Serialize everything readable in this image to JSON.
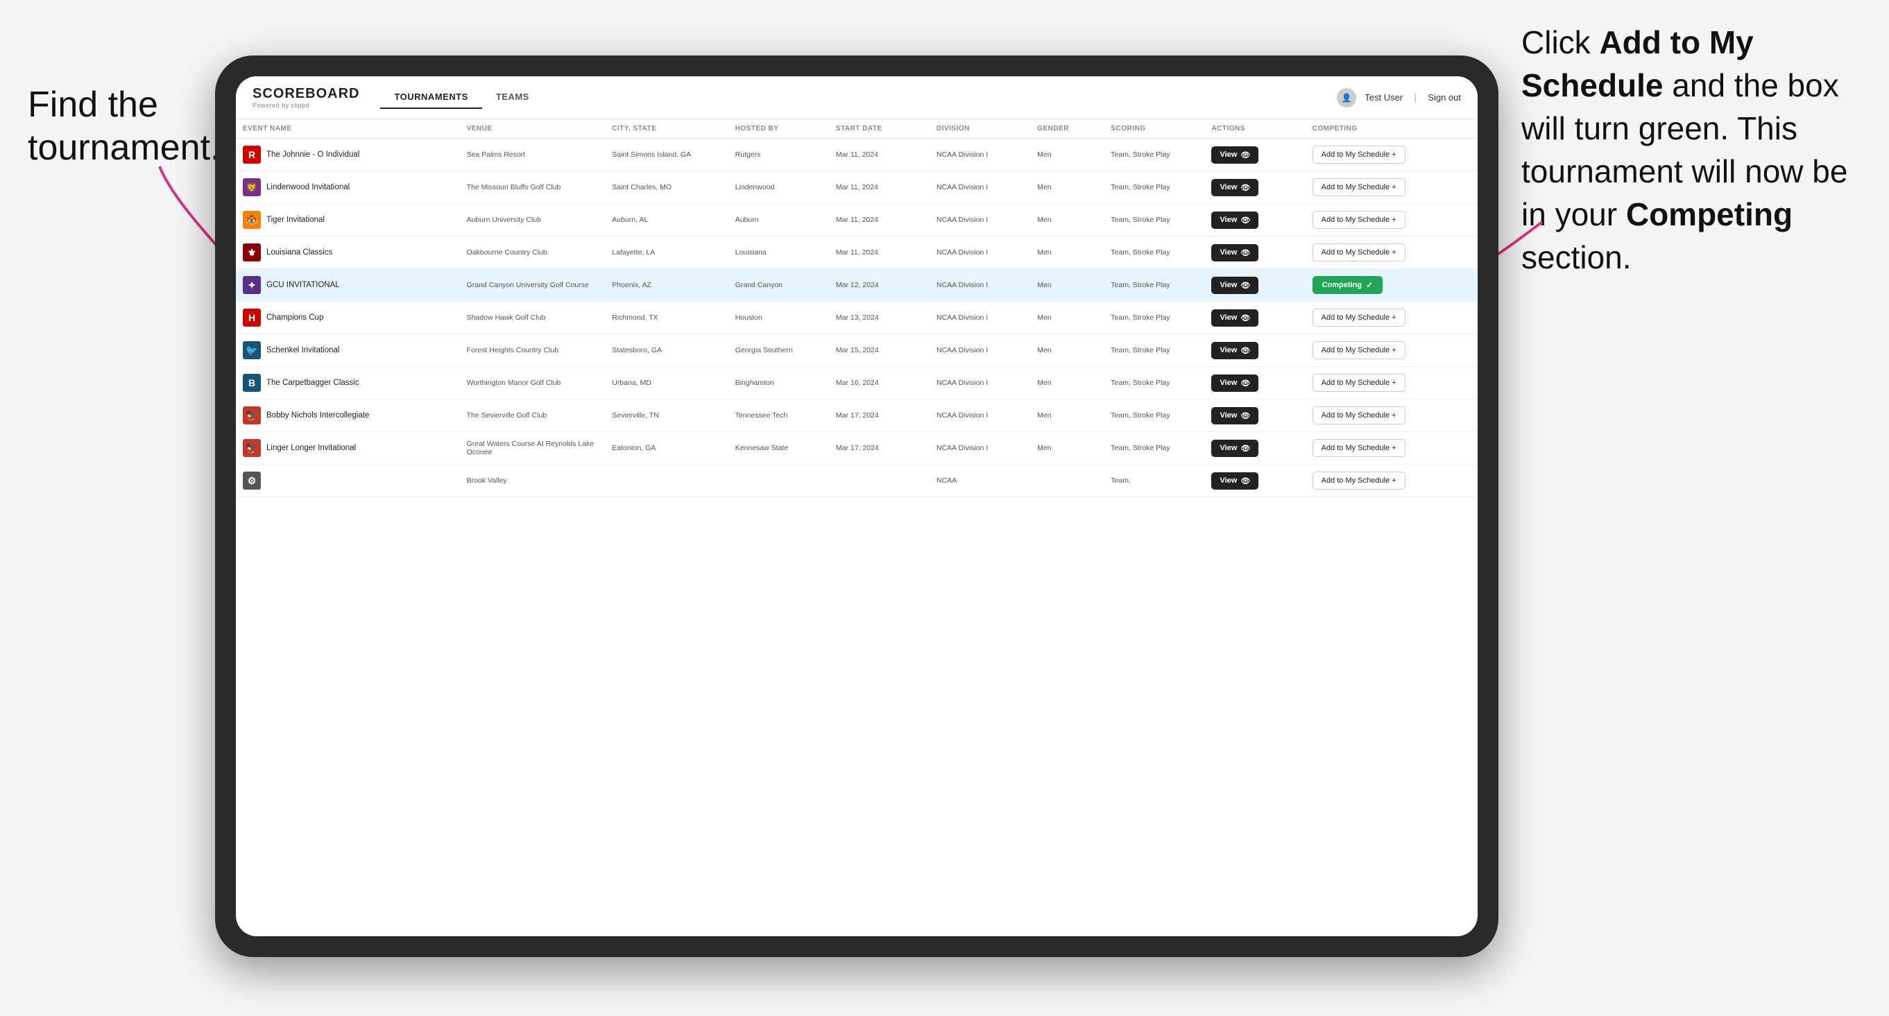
{
  "annotations": {
    "left_title": "Find the tournament.",
    "right_text_1": "Click ",
    "right_bold_1": "Add to My Schedule",
    "right_text_2": " and the box will turn green. This tournament will now be in your ",
    "right_bold_2": "Competing",
    "right_text_3": " section."
  },
  "header": {
    "logo": "SCOREBOARD",
    "logo_sub": "Powered by clippd",
    "tabs": [
      "TOURNAMENTS",
      "TEAMS"
    ],
    "active_tab": "TOURNAMENTS",
    "user": "Test User",
    "signout": "Sign out"
  },
  "table": {
    "columns": [
      "EVENT NAME",
      "VENUE",
      "CITY, STATE",
      "HOSTED BY",
      "START DATE",
      "DIVISION",
      "GENDER",
      "SCORING",
      "ACTIONS",
      "COMPETING"
    ],
    "rows": [
      {
        "logo": "R",
        "logo_color": "#cc0000",
        "event": "The Johnnie - O Individual",
        "venue": "Sea Palms Resort",
        "city": "Saint Simons Island, GA",
        "hosted": "Rutgers",
        "date": "Mar 11, 2024",
        "division": "NCAA Division I",
        "gender": "Men",
        "scoring": "Team, Stroke Play",
        "view_label": "View",
        "action_label": "Add to My Schedule +",
        "competing": false,
        "highlighted": false
      },
      {
        "logo": "🦁",
        "logo_color": "#7b2d8b",
        "event": "Lindenwood Invitational",
        "venue": "The Missouri Bluffs Golf Club",
        "city": "Saint Charles, MO",
        "hosted": "Lindenwood",
        "date": "Mar 11, 2024",
        "division": "NCAA Division I",
        "gender": "Men",
        "scoring": "Team, Stroke Play",
        "view_label": "View",
        "action_label": "Add to My Schedule +",
        "competing": false,
        "highlighted": false
      },
      {
        "logo": "🐯",
        "logo_color": "#f77f00",
        "event": "Tiger Invitational",
        "venue": "Auburn University Club",
        "city": "Auburn, AL",
        "hosted": "Auburn",
        "date": "Mar 11, 2024",
        "division": "NCAA Division I",
        "gender": "Men",
        "scoring": "Team, Stroke Play",
        "view_label": "View",
        "action_label": "Add to My Schedule +",
        "competing": false,
        "highlighted": false
      },
      {
        "logo": "⚜",
        "logo_color": "#8b0000",
        "event": "Louisiana Classics",
        "venue": "Oakbourne Country Club",
        "city": "Lafayette, LA",
        "hosted": "Louisiana",
        "date": "Mar 11, 2024",
        "division": "NCAA Division I",
        "gender": "Men",
        "scoring": "Team, Stroke Play",
        "view_label": "View",
        "action_label": "Add to My Schedule +",
        "competing": false,
        "highlighted": false
      },
      {
        "logo": "✦",
        "logo_color": "#5b2d8b",
        "event": "GCU INVITATIONAL",
        "venue": "Grand Canyon University Golf Course",
        "city": "Phoenix, AZ",
        "hosted": "Grand Canyon",
        "date": "Mar 12, 2024",
        "division": "NCAA Division I",
        "gender": "Men",
        "scoring": "Team, Stroke Play",
        "view_label": "View",
        "action_label": "Competing ✓",
        "competing": true,
        "highlighted": true
      },
      {
        "logo": "H",
        "logo_color": "#cc0000",
        "event": "Champions Cup",
        "venue": "Shadow Hawk Golf Club",
        "city": "Richmond, TX",
        "hosted": "Houston",
        "date": "Mar 13, 2024",
        "division": "NCAA Division I",
        "gender": "Men",
        "scoring": "Team, Stroke Play",
        "view_label": "View",
        "action_label": "Add to My Schedule +",
        "competing": false,
        "highlighted": false
      },
      {
        "logo": "🐦",
        "logo_color": "#1a5276",
        "event": "Schenkel Invitational",
        "venue": "Forest Heights Country Club",
        "city": "Statesboro, GA",
        "hosted": "Georgia Southern",
        "date": "Mar 15, 2024",
        "division": "NCAA Division I",
        "gender": "Men",
        "scoring": "Team, Stroke Play",
        "view_label": "View",
        "action_label": "Add to My Schedule +",
        "competing": false,
        "highlighted": false
      },
      {
        "logo": "B",
        "logo_color": "#1a5276",
        "event": "The Carpetbagger Classic",
        "venue": "Worthington Manor Golf Club",
        "city": "Urbana, MD",
        "hosted": "Binghamton",
        "date": "Mar 16, 2024",
        "division": "NCAA Division I",
        "gender": "Men",
        "scoring": "Team, Stroke Play",
        "view_label": "View",
        "action_label": "Add to My Schedule +",
        "competing": false,
        "highlighted": false
      },
      {
        "logo": "🦅",
        "logo_color": "#c0392b",
        "event": "Bobby Nichols Intercollegiate",
        "venue": "The Sevierville Golf Club",
        "city": "Sevierville, TN",
        "hosted": "Tennessee Tech",
        "date": "Mar 17, 2024",
        "division": "NCAA Division I",
        "gender": "Men",
        "scoring": "Team, Stroke Play",
        "view_label": "View",
        "action_label": "Add to My Schedule +",
        "competing": false,
        "highlighted": false
      },
      {
        "logo": "🦅",
        "logo_color": "#c0392b",
        "event": "Linger Longer Invitational",
        "venue": "Great Waters Course At Reynolds Lake Oconee",
        "city": "Eatonton, GA",
        "hosted": "Kennesaw State",
        "date": "Mar 17, 2024",
        "division": "NCAA Division I",
        "gender": "Men",
        "scoring": "Team, Stroke Play",
        "view_label": "View",
        "action_label": "Add to My Schedule +",
        "competing": false,
        "highlighted": false
      },
      {
        "logo": "⚙",
        "logo_color": "#555",
        "event": "",
        "venue": "Brook Valley",
        "city": "",
        "hosted": "",
        "date": "",
        "division": "NCAA",
        "gender": "",
        "scoring": "Team,",
        "view_label": "View",
        "action_label": "Add to My Schedule +",
        "competing": false,
        "highlighted": false
      }
    ]
  }
}
